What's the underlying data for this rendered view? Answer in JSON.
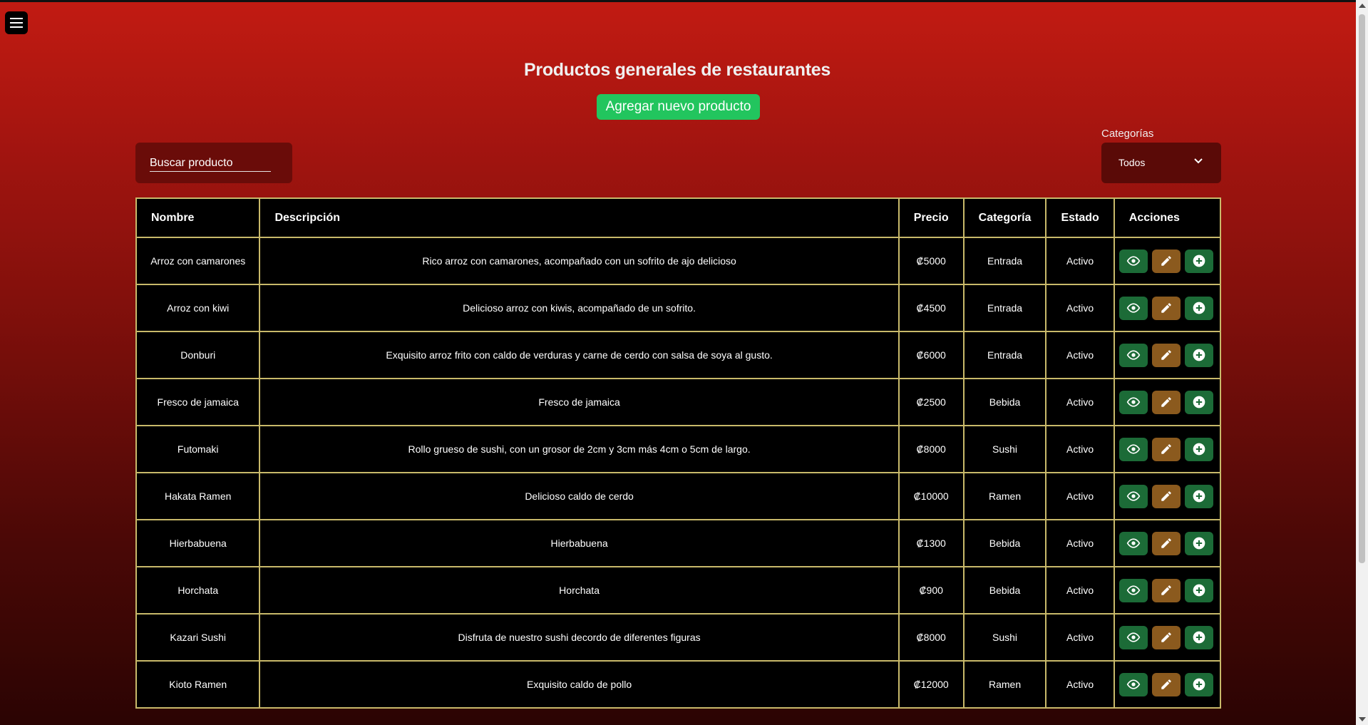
{
  "header": {
    "menu_icon": "hamburger-menu-icon",
    "title": "Productos generales de restaurantes",
    "add_button": "Agregar nuevo producto"
  },
  "search": {
    "placeholder": "Buscar producto"
  },
  "filter": {
    "label": "Categorías",
    "selected": "Todos"
  },
  "table": {
    "columns": [
      "Nombre",
      "Descripción",
      "Precio",
      "Categoría",
      "Estado",
      "Acciones"
    ],
    "rows": [
      {
        "nombre": "Arroz con camarones",
        "descripcion": "Rico arroz con camarones, acompañado con un sofrito de ajo delicioso",
        "precio": "₡5000",
        "categoria": "Entrada",
        "estado": "Activo"
      },
      {
        "nombre": "Arroz con kiwi",
        "descripcion": "Delicioso arroz con kiwis, acompañado de un sofrito.",
        "precio": "₡4500",
        "categoria": "Entrada",
        "estado": "Activo"
      },
      {
        "nombre": "Donburi",
        "descripcion": "Exquisito arroz frito con caldo de verduras y carne de cerdo con salsa de soya al gusto.",
        "precio": "₡6000",
        "categoria": "Entrada",
        "estado": "Activo"
      },
      {
        "nombre": "Fresco de jamaica",
        "descripcion": "Fresco de jamaica",
        "precio": "₡2500",
        "categoria": "Bebida",
        "estado": "Activo"
      },
      {
        "nombre": "Futomaki",
        "descripcion": "Rollo grueso de sushi, con un grosor de 2cm y 3cm más 4cm o 5cm de largo.",
        "precio": "₡8000",
        "categoria": "Sushi",
        "estado": "Activo"
      },
      {
        "nombre": "Hakata Ramen",
        "descripcion": "Delicioso caldo de cerdo",
        "precio": "₡10000",
        "categoria": "Ramen",
        "estado": "Activo"
      },
      {
        "nombre": "Hierbabuena",
        "descripcion": "Hierbabuena",
        "precio": "₡1300",
        "categoria": "Bebida",
        "estado": "Activo"
      },
      {
        "nombre": "Horchata",
        "descripcion": "Horchata",
        "precio": "₡900",
        "categoria": "Bebida",
        "estado": "Activo"
      },
      {
        "nombre": "Kazari Sushi",
        "descripcion": "Disfruta de nuestro sushi decordo de diferentes figuras",
        "precio": "₡8000",
        "categoria": "Sushi",
        "estado": "Activo"
      },
      {
        "nombre": "Kioto Ramen",
        "descripcion": "Exquisito caldo de pollo",
        "precio": "₡12000",
        "categoria": "Ramen",
        "estado": "Activo"
      }
    ],
    "action_icons": [
      "eye-icon",
      "pencil-icon",
      "plus-circle-icon"
    ]
  },
  "colors": {
    "background_top": "#c21b12",
    "background_bottom": "#2b0403",
    "add_button": "#22c55e",
    "table_border": "#c8b96a",
    "view_button": "#1c6b37",
    "edit_button": "#8b5a1e"
  }
}
